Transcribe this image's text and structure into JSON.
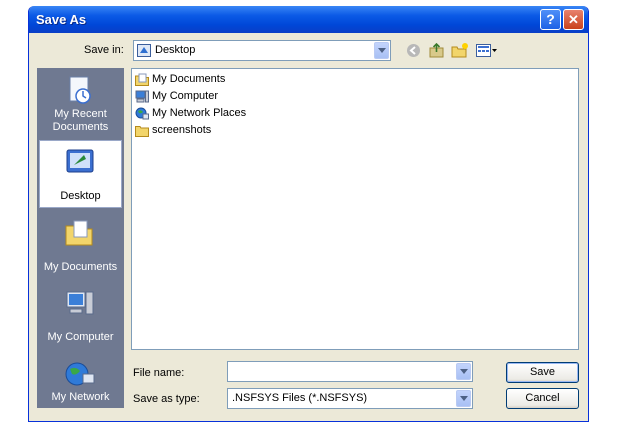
{
  "window": {
    "title": "Save As",
    "help_glyph": "?",
    "close_glyph": "✕"
  },
  "toolbar": {
    "save_in_label": "Save in:",
    "save_in_value": "Desktop",
    "back_icon": "back-arrow-icon",
    "up_icon": "up-folder-icon",
    "new_folder_icon": "new-folder-icon",
    "views_icon": "views-menu-icon"
  },
  "places": [
    {
      "label": "My Recent Documents",
      "icon": "recent-documents-icon",
      "selected": false
    },
    {
      "label": "Desktop",
      "icon": "desktop-icon",
      "selected": true
    },
    {
      "label": "My Documents",
      "icon": "my-documents-icon",
      "selected": false
    },
    {
      "label": "My Computer",
      "icon": "my-computer-icon",
      "selected": false
    },
    {
      "label": "My Network",
      "icon": "my-network-icon",
      "selected": false
    }
  ],
  "files": [
    {
      "name": "My Documents",
      "icon": "documents-folder-icon"
    },
    {
      "name": "My Computer",
      "icon": "computer-icon"
    },
    {
      "name": "My Network Places",
      "icon": "network-places-icon"
    },
    {
      "name": "screenshots",
      "icon": "folder-icon"
    }
  ],
  "form": {
    "file_name_label": "File name:",
    "file_name_value": "",
    "type_label": "Save as type:",
    "type_value": ".NSFSYS Files (*.NSFSYS)",
    "save_label": "Save",
    "cancel_label": "Cancel"
  },
  "colors": {
    "titlebar": "#0054e3",
    "dialog_bg": "#ece9d8",
    "places_bar": "#6f7991",
    "input_border": "#7f9db9"
  }
}
